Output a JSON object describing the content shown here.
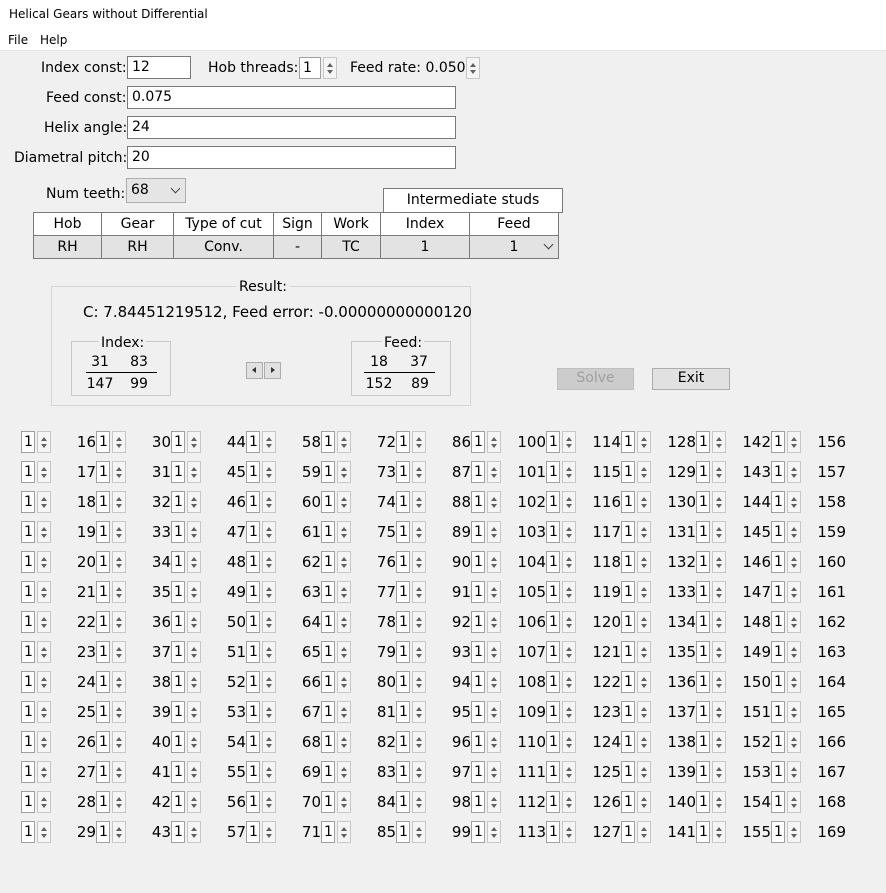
{
  "window": {
    "title": "Helical Gears without Differential"
  },
  "menu": [
    "File",
    "Help"
  ],
  "inputs": {
    "index_const_label": "Index const:",
    "index_const": "12",
    "hob_threads_label": "Hob threads:",
    "hob_threads": "1",
    "feed_rate_label": "Feed rate: 0.050",
    "feed_const_label": "Feed const:",
    "feed_const": "0.075",
    "helix_angle_label": "Helix angle:",
    "helix_angle": "24",
    "diametral_pitch_label": "Diametral pitch:",
    "diametral_pitch": "20",
    "num_teeth_label": "Num teeth:",
    "num_teeth": "68"
  },
  "table": {
    "group_header": "Intermediate studs",
    "headers": [
      "Hob",
      "Gear",
      "Type of cut",
      "Sign",
      "Work",
      "Index",
      "Feed"
    ],
    "row": [
      "RH",
      "RH",
      "Conv.",
      "-",
      "TC",
      "1",
      "1"
    ]
  },
  "result": {
    "title": "Result:",
    "summary": "C: 7.84451219512, Feed error: -0.00000000000120",
    "index": {
      "title": "Index:",
      "num": [
        "31",
        "83"
      ],
      "den": [
        "147",
        "99"
      ]
    },
    "feed": {
      "title": "Feed:",
      "num": [
        "18",
        "37"
      ],
      "den": [
        "152",
        "89"
      ]
    }
  },
  "buttons": {
    "solve": "Solve",
    "exit": "Exit"
  },
  "gears": {
    "count_value": "1",
    "columns": [
      [
        "16",
        "17",
        "18",
        "19",
        "20",
        "21",
        "22",
        "23",
        "24",
        "25",
        "26",
        "27",
        "28",
        "29"
      ],
      [
        "30",
        "31",
        "32",
        "33",
        "34",
        "35",
        "36",
        "37",
        "38",
        "39",
        "40",
        "41",
        "42",
        "43"
      ],
      [
        "44",
        "45",
        "46",
        "47",
        "48",
        "49",
        "50",
        "51",
        "52",
        "53",
        "54",
        "55",
        "56",
        "57"
      ],
      [
        "58",
        "59",
        "60",
        "61",
        "62",
        "63",
        "64",
        "65",
        "66",
        "67",
        "68",
        "69",
        "70",
        "71"
      ],
      [
        "72",
        "73",
        "74",
        "75",
        "76",
        "77",
        "78",
        "79",
        "80",
        "81",
        "82",
        "83",
        "84",
        "85"
      ],
      [
        "86",
        "87",
        "88",
        "89",
        "90",
        "91",
        "92",
        "93",
        "94",
        "95",
        "96",
        "97",
        "98",
        "99"
      ],
      [
        "100",
        "101",
        "102",
        "103",
        "104",
        "105",
        "106",
        "107",
        "108",
        "109",
        "110",
        "111",
        "112",
        "113"
      ],
      [
        "114",
        "115",
        "116",
        "117",
        "118",
        "119",
        "120",
        "121",
        "122",
        "123",
        "124",
        "125",
        "126",
        "127"
      ],
      [
        "128",
        "129",
        "130",
        "131",
        "132",
        "133",
        "134",
        "135",
        "136",
        "137",
        "138",
        "139",
        "140",
        "141"
      ],
      [
        "142",
        "143",
        "144",
        "145",
        "146",
        "147",
        "148",
        "149",
        "150",
        "151",
        "152",
        "153",
        "154",
        "155"
      ],
      [
        "156",
        "157",
        "158",
        "159",
        "160",
        "161",
        "162",
        "163",
        "164",
        "165",
        "166",
        "167",
        "168",
        "169"
      ]
    ]
  }
}
